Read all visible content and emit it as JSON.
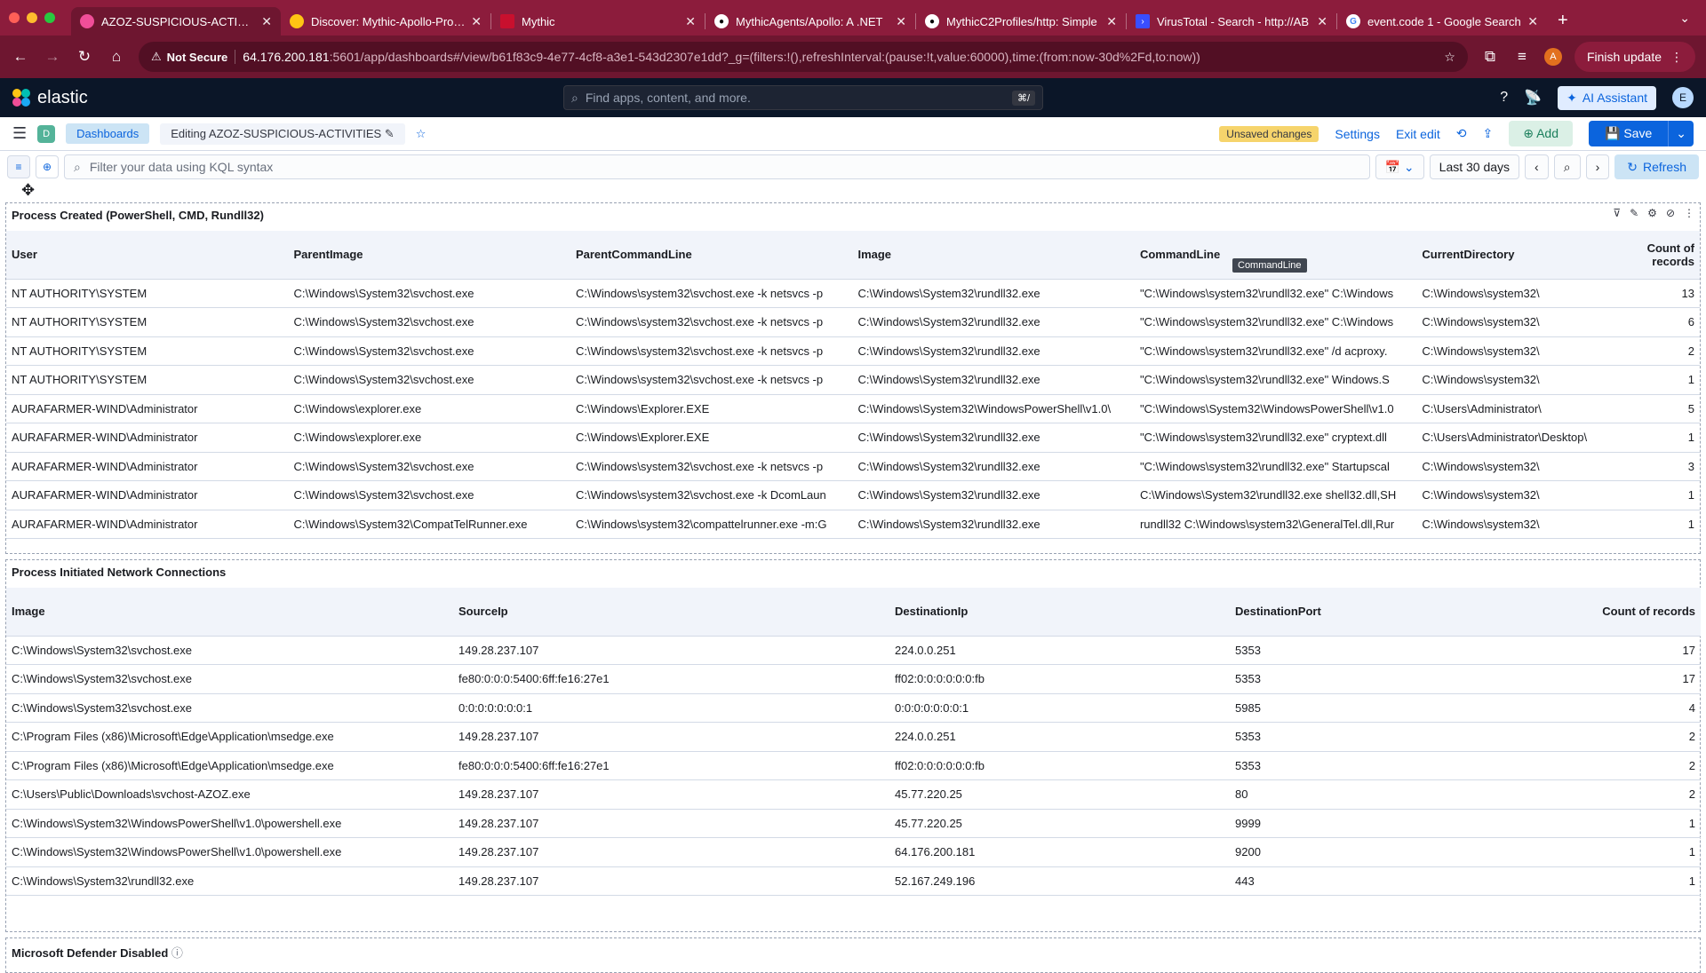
{
  "browser": {
    "tabs": [
      {
        "title": "AZOZ-SUSPICIOUS-ACTIVITIES",
        "active": true,
        "favicon": "elastic-icon"
      },
      {
        "title": "Discover: Mythic-Apollo-Process",
        "active": false,
        "favicon": "elastic-icon"
      },
      {
        "title": "Mythic",
        "active": false,
        "favicon": "mythic-icon"
      },
      {
        "title": "MythicAgents/Apollo: A .NET",
        "active": false,
        "favicon": "github-icon"
      },
      {
        "title": "MythicC2Profiles/http: Simple",
        "active": false,
        "favicon": "github-icon"
      },
      {
        "title": "VirusTotal - Search - http://AB",
        "active": false,
        "favicon": "virustotal-icon"
      },
      {
        "title": "event.code 1 - Google Search",
        "active": false,
        "favicon": "google-icon"
      }
    ],
    "security_label": "Not Secure",
    "url_host": "64.176.200.181",
    "url_rest": ":5601/app/dashboards#/view/b61f83c9-4e77-4cf8-a3e1-543d2307e1dd?_g=(filters:!(),refreshInterval:(pause:!t,value:60000),time:(from:now-30d%2Fd,to:now))",
    "profile_initial": "A",
    "finish_update": "Finish update"
  },
  "elastic": {
    "logo_text": "elastic",
    "search_placeholder": "Find apps, content, and more.",
    "search_shortcut": "⌘/",
    "ai_assistant": "AI Assistant",
    "user_initial": "E"
  },
  "breadcrumbs": {
    "space_initial": "D",
    "items": [
      "Dashboards",
      "Editing AZOZ-SUSPICIOUS-ACTIVITIES"
    ],
    "unsaved": "Unsaved changes",
    "settings": "Settings",
    "exit_edit": "Exit edit",
    "add": "Add",
    "save": "Save"
  },
  "querybar": {
    "placeholder": "Filter your data using KQL syntax",
    "date_range": "Last 30 days",
    "refresh": "Refresh"
  },
  "panel1": {
    "title": "Process Created (PowerShell, CMD, Rundll32)",
    "columns": [
      "User",
      "ParentImage",
      "ParentCommandLine",
      "Image",
      "CommandLine",
      "CurrentDirectory",
      "Count of records"
    ],
    "tooltip": "CommandLine",
    "rows": [
      [
        "NT AUTHORITY\\SYSTEM",
        "C:\\Windows\\System32\\svchost.exe",
        "C:\\Windows\\system32\\svchost.exe -k netsvcs -p",
        "C:\\Windows\\System32\\rundll32.exe",
        "\"C:\\Windows\\system32\\rundll32.exe\" C:\\Windows",
        "C:\\Windows\\system32\\",
        "13"
      ],
      [
        "NT AUTHORITY\\SYSTEM",
        "C:\\Windows\\System32\\svchost.exe",
        "C:\\Windows\\system32\\svchost.exe -k netsvcs -p",
        "C:\\Windows\\System32\\rundll32.exe",
        "\"C:\\Windows\\system32\\rundll32.exe\" C:\\Windows",
        "C:\\Windows\\system32\\",
        "6"
      ],
      [
        "NT AUTHORITY\\SYSTEM",
        "C:\\Windows\\System32\\svchost.exe",
        "C:\\Windows\\system32\\svchost.exe -k netsvcs -p",
        "C:\\Windows\\System32\\rundll32.exe",
        "\"C:\\Windows\\system32\\rundll32.exe\" /d acproxy.",
        "C:\\Windows\\system32\\",
        "2"
      ],
      [
        "NT AUTHORITY\\SYSTEM",
        "C:\\Windows\\System32\\svchost.exe",
        "C:\\Windows\\system32\\svchost.exe -k netsvcs -p",
        "C:\\Windows\\System32\\rundll32.exe",
        "\"C:\\Windows\\system32\\rundll32.exe\" Windows.S",
        "C:\\Windows\\system32\\",
        "1"
      ],
      [
        "AURAFARMER-WIND\\Administrator",
        "C:\\Windows\\explorer.exe",
        "C:\\Windows\\Explorer.EXE",
        "C:\\Windows\\System32\\WindowsPowerShell\\v1.0\\",
        "\"C:\\Windows\\System32\\WindowsPowerShell\\v1.0",
        "C:\\Users\\Administrator\\",
        "5"
      ],
      [
        "AURAFARMER-WIND\\Administrator",
        "C:\\Windows\\explorer.exe",
        "C:\\Windows\\Explorer.EXE",
        "C:\\Windows\\System32\\rundll32.exe",
        "\"C:\\Windows\\system32\\rundll32.exe\" cryptext.dll",
        "C:\\Users\\Administrator\\Desktop\\",
        "1"
      ],
      [
        "AURAFARMER-WIND\\Administrator",
        "C:\\Windows\\System32\\svchost.exe",
        "C:\\Windows\\system32\\svchost.exe -k netsvcs -p",
        "C:\\Windows\\System32\\rundll32.exe",
        "\"C:\\Windows\\system32\\rundll32.exe\" Startupscal",
        "C:\\Windows\\system32\\",
        "3"
      ],
      [
        "AURAFARMER-WIND\\Administrator",
        "C:\\Windows\\System32\\svchost.exe",
        "C:\\Windows\\system32\\svchost.exe -k DcomLaun",
        "C:\\Windows\\System32\\rundll32.exe",
        "C:\\Windows\\System32\\rundll32.exe shell32.dll,SH",
        "C:\\Windows\\system32\\",
        "1"
      ],
      [
        "AURAFARMER-WIND\\Administrator",
        "C:\\Windows\\System32\\CompatTelRunner.exe",
        "C:\\Windows\\system32\\compattelrunner.exe -m:G",
        "C:\\Windows\\System32\\rundll32.exe",
        "rundll32 C:\\Windows\\system32\\GeneralTel.dll,Rur",
        "C:\\Windows\\system32\\",
        "1"
      ]
    ]
  },
  "panel2": {
    "title": "Process Initiated Network Connections",
    "columns": [
      "Image",
      "SourceIp",
      "DestinationIp",
      "DestinationPort",
      "Count of records"
    ],
    "rows": [
      [
        "C:\\Windows\\System32\\svchost.exe",
        "149.28.237.107",
        "224.0.0.251",
        "5353",
        "17"
      ],
      [
        "C:\\Windows\\System32\\svchost.exe",
        "fe80:0:0:0:5400:6ff:fe16:27e1",
        "ff02:0:0:0:0:0:0:fb",
        "5353",
        "17"
      ],
      [
        "C:\\Windows\\System32\\svchost.exe",
        "0:0:0:0:0:0:0:1",
        "0:0:0:0:0:0:0:1",
        "5985",
        "4"
      ],
      [
        "C:\\Program Files (x86)\\Microsoft\\Edge\\Application\\msedge.exe",
        "149.28.237.107",
        "224.0.0.251",
        "5353",
        "2"
      ],
      [
        "C:\\Program Files (x86)\\Microsoft\\Edge\\Application\\msedge.exe",
        "fe80:0:0:0:5400:6ff:fe16:27e1",
        "ff02:0:0:0:0:0:0:fb",
        "5353",
        "2"
      ],
      [
        "C:\\Users\\Public\\Downloads\\svchost-AZOZ.exe",
        "149.28.237.107",
        "45.77.220.25",
        "80",
        "2"
      ],
      [
        "C:\\Windows\\System32\\WindowsPowerShell\\v1.0\\powershell.exe",
        "149.28.237.107",
        "45.77.220.25",
        "9999",
        "1"
      ],
      [
        "C:\\Windows\\System32\\WindowsPowerShell\\v1.0\\powershell.exe",
        "149.28.237.107",
        "64.176.200.181",
        "9200",
        "1"
      ],
      [
        "C:\\Windows\\System32\\rundll32.exe",
        "149.28.237.107",
        "52.167.249.196",
        "443",
        "1"
      ]
    ]
  },
  "panel3": {
    "title": "Microsoft Defender Disabled"
  }
}
